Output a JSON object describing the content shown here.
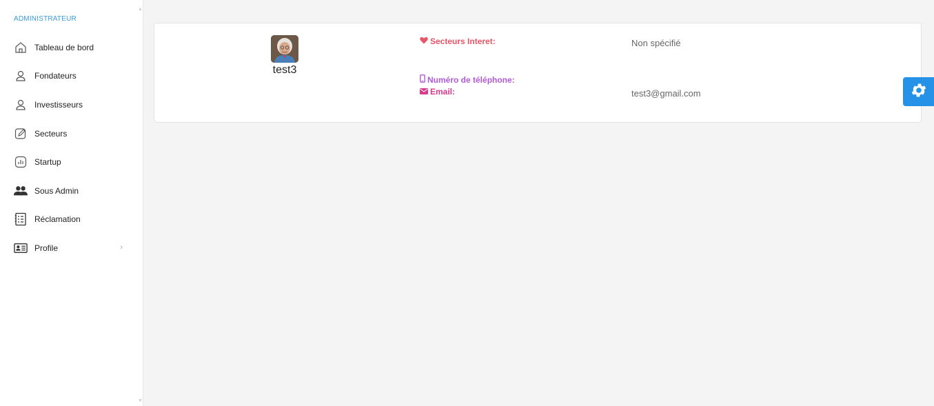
{
  "sidebar": {
    "section_title": "ADMINISTRATEUR",
    "items": [
      {
        "label": "Tableau de bord",
        "icon": "home-icon"
      },
      {
        "label": "Fondateurs",
        "icon": "user-icon"
      },
      {
        "label": "Investisseurs",
        "icon": "user-icon"
      },
      {
        "label": "Secteurs",
        "icon": "edit-icon"
      },
      {
        "label": "Startup",
        "icon": "chart-icon"
      },
      {
        "label": "Sous Admin",
        "icon": "users-icon"
      },
      {
        "label": "Réclamation",
        "icon": "list-icon"
      },
      {
        "label": "Profile",
        "icon": "id-card-icon",
        "has_submenu": true
      }
    ]
  },
  "profile": {
    "username": "test3",
    "sectors_label": "Secteurs Interet:",
    "sectors_value": "Non spécifié",
    "phone_label": "Numéro de téléphone:",
    "phone_value": "",
    "email_label": "Email:",
    "email_value": "test3@gmail.com"
  },
  "colors": {
    "accent": "#3a9ad9",
    "sectors_label": "#e8566a",
    "phone_label": "#b15ad7",
    "email_label": "#d63b8c",
    "settings_button": "#2592e8"
  }
}
